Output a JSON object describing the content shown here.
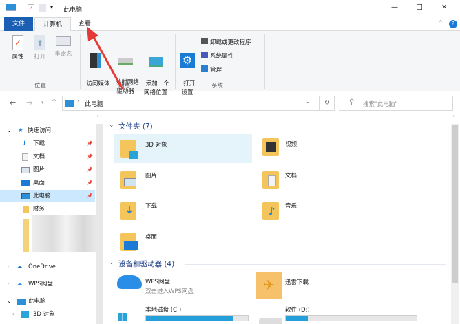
{
  "window": {
    "title": "此电脑",
    "minimize": "—",
    "maximize": "☐",
    "close": "✕"
  },
  "tabs": [
    {
      "label": "文件"
    },
    {
      "label": "计算机"
    },
    {
      "label": "查看"
    }
  ],
  "ribbon": {
    "groups": [
      {
        "label": "位置",
        "buttons": [
          "属性",
          "打开",
          "重命名"
        ]
      },
      {
        "label": "网络",
        "buttons": [
          "访问媒体",
          "映射网络\n驱动器",
          "添加一个\n网络位置"
        ]
      },
      {
        "label": "系统",
        "buttons": [
          "打开\n设置"
        ],
        "small": [
          "卸载或更改程序",
          "系统属性",
          "管理"
        ]
      }
    ]
  },
  "address": {
    "path": "此电脑",
    "search_placeholder": "搜索\"此电脑\""
  },
  "nav": {
    "quick_access": "快速访问",
    "items": [
      "下载",
      "文档",
      "图片",
      "桌面",
      "此电脑",
      "财务"
    ],
    "onedrive": "OneDrive",
    "wps": "WPS网盘",
    "this_pc": "此电脑",
    "obj3d": "3D 对象"
  },
  "content": {
    "folders_header": "文件夹 (7)",
    "folders": [
      "3D 对象",
      "视频",
      "图片",
      "文档",
      "下载",
      "音乐",
      "桌面"
    ],
    "devices_header": "设备和驱动器 (4)",
    "wps": {
      "name": "WPS网盘",
      "sub": "双击进入WPS网盘"
    },
    "xunlei": "迅雷下载",
    "drive_c": {
      "name": "本地磁盘 (C:)",
      "used": 0.86
    },
    "drive_d": {
      "name": "软件 (D:)",
      "used": 0.17
    }
  }
}
